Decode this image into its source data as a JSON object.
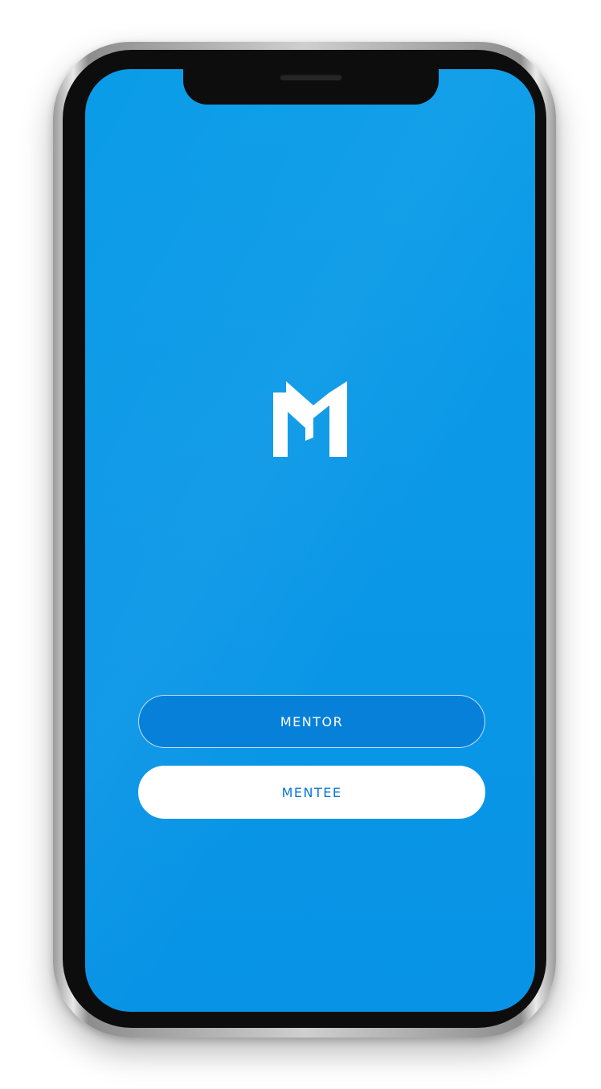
{
  "app": {
    "logo_icon": "mentorship-m-logo",
    "background_color": "#0B98E7"
  },
  "buttons": {
    "mentor_label": "MENTOR",
    "mentee_label": "MENTEE"
  },
  "colors": {
    "mentor_button_fill": "#0780D9",
    "mentee_button_fill": "#FFFFFF",
    "mentee_text": "#0678D4"
  }
}
